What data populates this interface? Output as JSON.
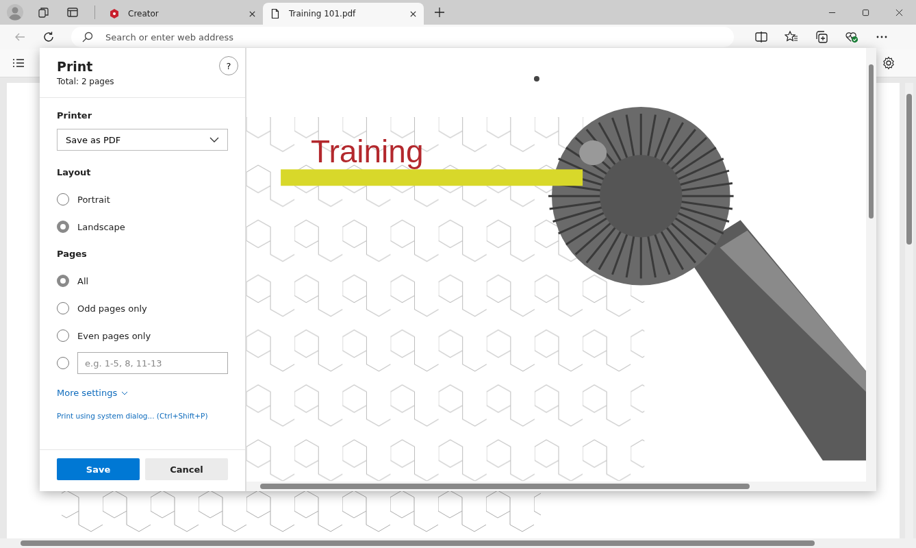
{
  "browser": {
    "tabs": [
      {
        "title": "Creator",
        "selected": false,
        "kind": "app"
      },
      {
        "title": "Training 101.pdf",
        "selected": true,
        "kind": "file"
      }
    ],
    "address_bar": {
      "placeholder": "Search or enter web address"
    }
  },
  "print_dialog": {
    "title": "Print",
    "total": "Total: 2 pages",
    "help": "?",
    "printer": {
      "label": "Printer",
      "value": "Save as PDF"
    },
    "layout": {
      "label": "Layout",
      "options": [
        {
          "label": "Portrait",
          "selected": false
        },
        {
          "label": "Landscape",
          "selected": true
        }
      ]
    },
    "pages": {
      "label": "Pages",
      "options": [
        {
          "label": "All",
          "selected": true
        },
        {
          "label": "Odd pages only",
          "selected": false
        },
        {
          "label": "Even pages only",
          "selected": false
        }
      ],
      "custom": {
        "placeholder": "e.g. 1-5, 8, 11-13",
        "selected": false
      }
    },
    "more_settings": "More settings",
    "system_dialog_link": "Print using system dialog... (Ctrl+Shift+P)",
    "buttons": [
      {
        "label": "Save",
        "kind": "primary"
      },
      {
        "label": "Cancel",
        "kind": "secondary"
      }
    ]
  },
  "preview": {
    "title": "Training"
  }
}
